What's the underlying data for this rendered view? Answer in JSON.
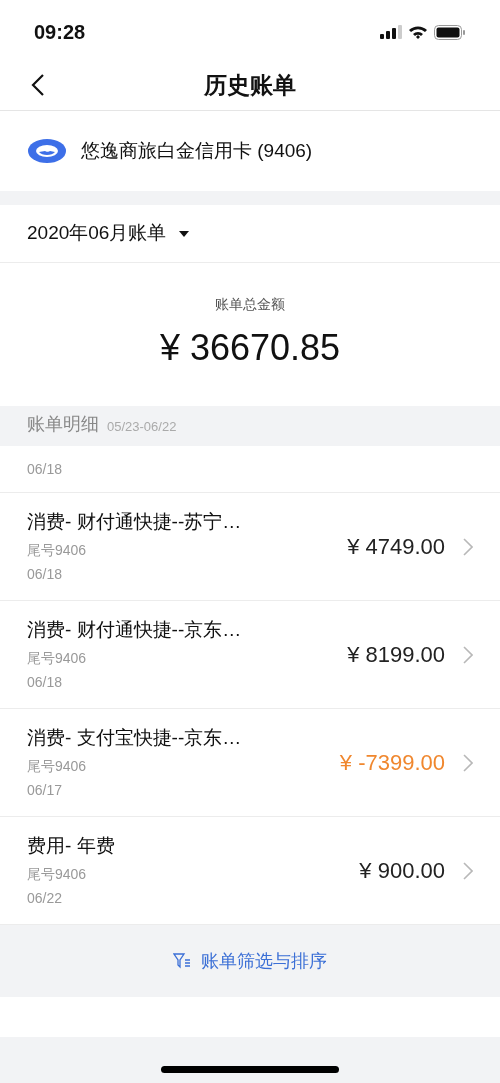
{
  "status_bar": {
    "time": "09:28"
  },
  "nav": {
    "title": "历史账单"
  },
  "card": {
    "name": "悠逸商旅白金信用卡 (9406)"
  },
  "statement": {
    "month": "2020年06月账单",
    "total_label": "账单总金额",
    "total": "¥ 36670.85"
  },
  "details": {
    "title": "账单明细",
    "period": "05/23-06/22"
  },
  "partial_row": {
    "date": "06/18"
  },
  "transactions": [
    {
      "title": "消费- 财付通快捷--苏宁…",
      "card": "尾号9406",
      "date": "06/18",
      "amount": "¥ 4749.00",
      "kind": "charge"
    },
    {
      "title": "消费- 财付通快捷--京东…",
      "card": "尾号9406",
      "date": "06/18",
      "amount": "¥ 8199.00",
      "kind": "charge"
    },
    {
      "title": "消费- 支付宝快捷--京东…",
      "card": "尾号9406",
      "date": "06/17",
      "amount": "¥ -7399.00",
      "kind": "refund"
    },
    {
      "title": "费用- 年费",
      "card": "尾号9406",
      "date": "06/22",
      "amount": "¥ 900.00",
      "kind": "charge"
    }
  ],
  "filter_button": {
    "label": "账单筛选与排序"
  }
}
